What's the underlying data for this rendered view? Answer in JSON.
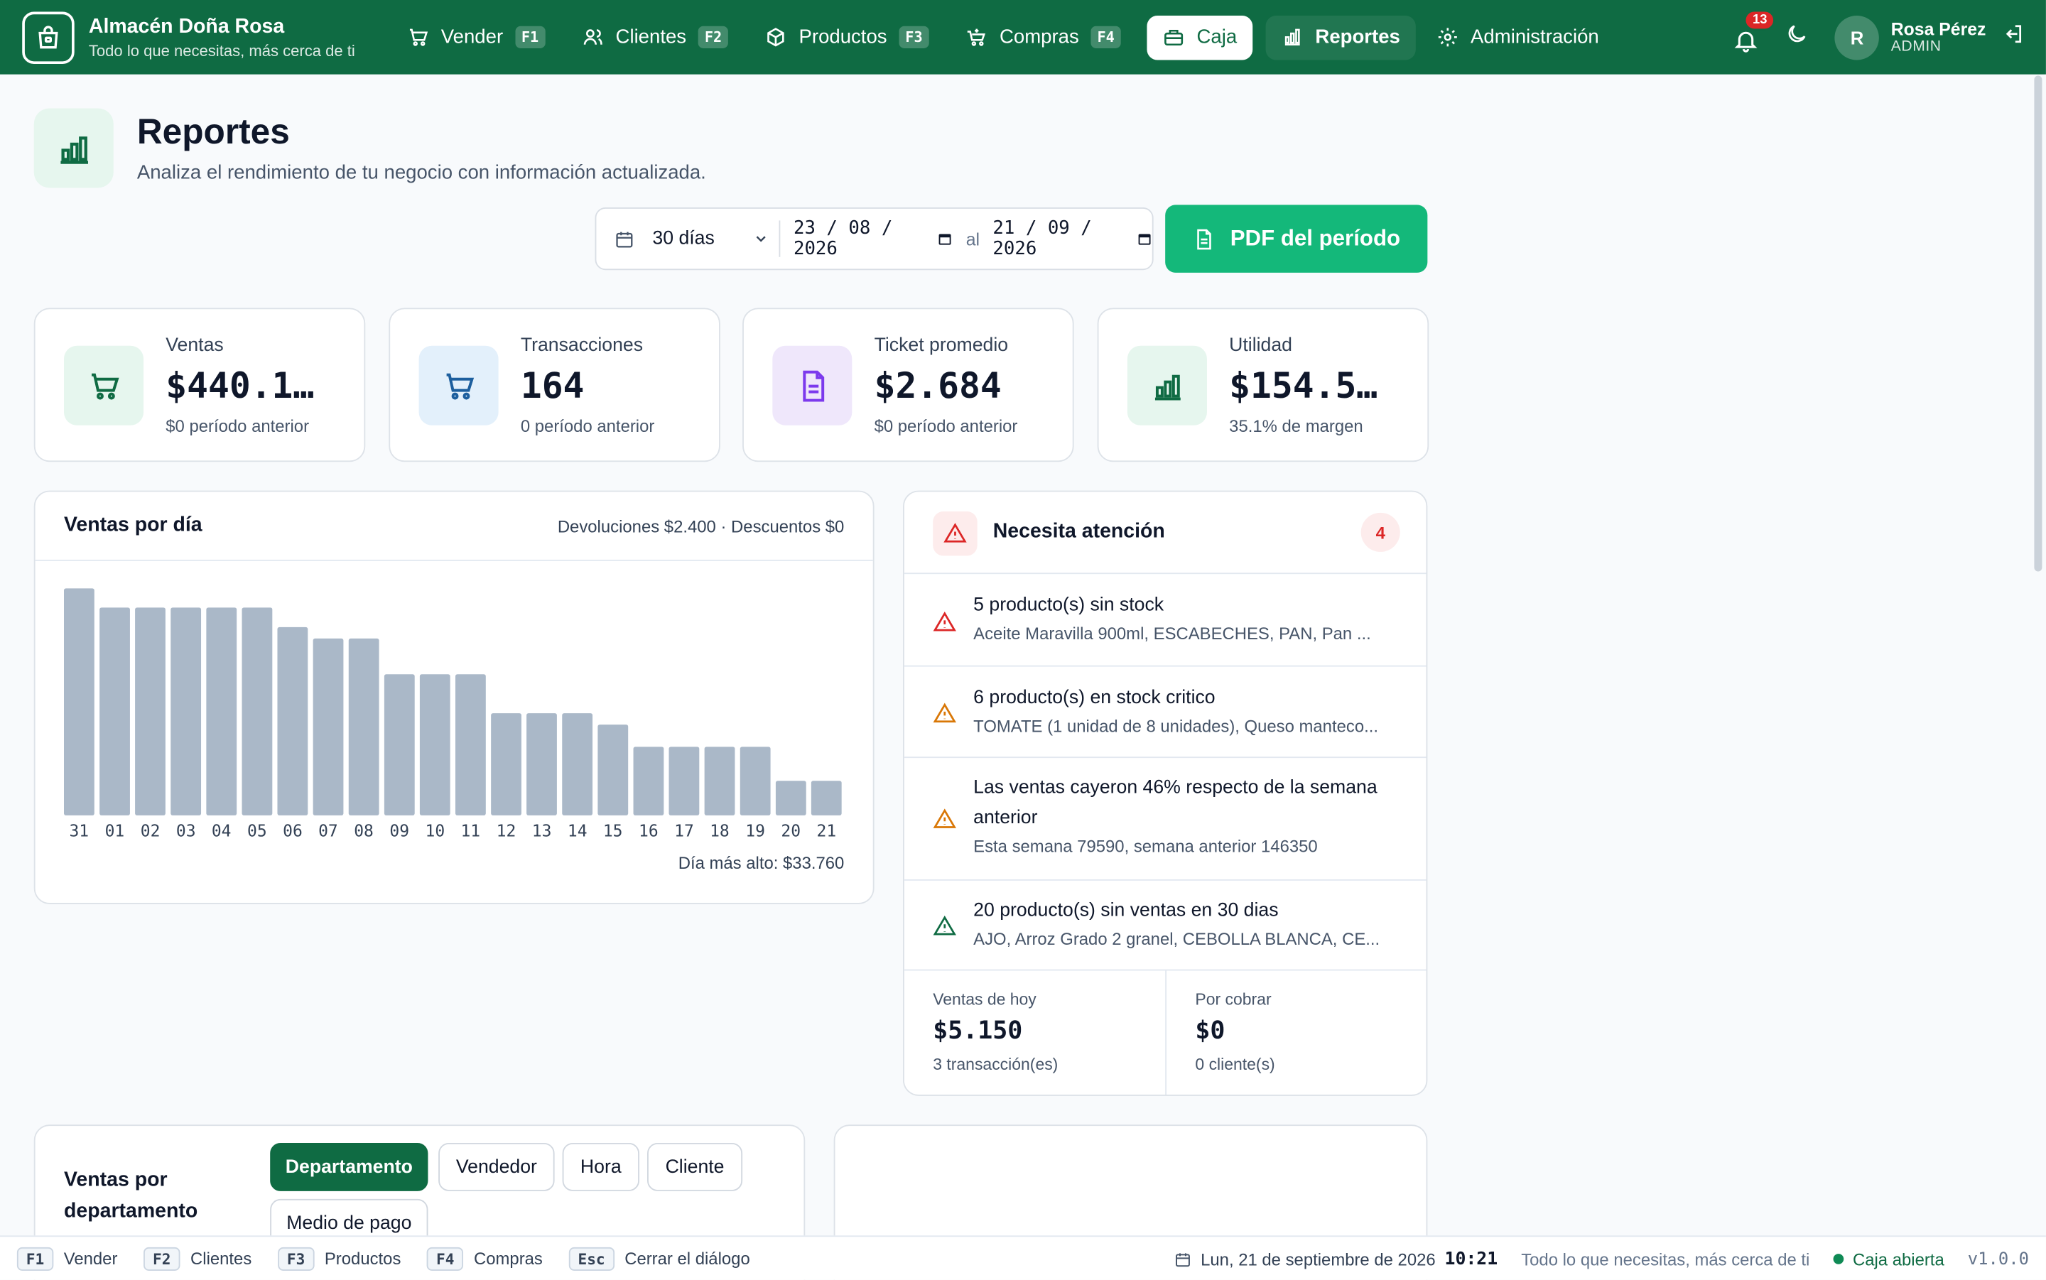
{
  "app": {
    "name": "Almacén Doña Rosa",
    "tagline": "Todo lo que necesitas, más cerca de ti"
  },
  "nav": [
    {
      "label": "Vender",
      "key": "F1",
      "icon": "cart-icon"
    },
    {
      "label": "Clientes",
      "key": "F2",
      "icon": "users-icon"
    },
    {
      "label": "Productos",
      "key": "F3",
      "icon": "box-icon"
    },
    {
      "label": "Compras",
      "key": "F4",
      "icon": "basket-icon"
    },
    {
      "label": "Caja",
      "key": "",
      "icon": "cash-register-icon"
    },
    {
      "label": "Reportes",
      "key": "",
      "icon": "bar-chart-icon"
    },
    {
      "label": "Administración",
      "key": "",
      "icon": "gear-icon"
    }
  ],
  "notifications": {
    "count": "13"
  },
  "user": {
    "initial": "R",
    "name": "Rosa Pérez",
    "role": "ADMIN"
  },
  "page": {
    "title": "Reportes",
    "subtitle": "Analiza el rendimiento de tu negocio con información actualizada."
  },
  "filters": {
    "range": "30 días",
    "from": "23 / 08 / 2026",
    "separator": "al",
    "to": "21 / 09 / 2026",
    "pdf_label": "PDF del período"
  },
  "kpis": [
    {
      "label": "Ventas",
      "value": "$440.1…",
      "sub": "$0 período anterior",
      "icon": "cart-icon",
      "bg": "#e6f6ee",
      "fg": "#0f6b43"
    },
    {
      "label": "Transacciones",
      "value": "164",
      "sub": "0 período anterior",
      "icon": "cart-icon",
      "bg": "#e3f0fb",
      "fg": "#1d5f9e"
    },
    {
      "label": "Ticket promedio",
      "value": "$2.684",
      "sub": "$0 período anterior",
      "icon": "document-icon",
      "bg": "#efe7fb",
      "fg": "#7c3aed"
    },
    {
      "label": "Utilidad",
      "value": "$154.5…",
      "sub": "35.1% de margen",
      "icon": "bar-chart-icon",
      "bg": "#e6f6ee",
      "fg": "#0f6b43"
    }
  ],
  "chart_data": {
    "type": "bar",
    "title": "Ventas por día",
    "note": "Devoluciones $2.400 · Descuentos $0",
    "categories": [
      "31",
      "01",
      "02",
      "03",
      "04",
      "05",
      "06",
      "07",
      "08",
      "09",
      "10",
      "11",
      "12",
      "13",
      "14",
      "15",
      "16",
      "17",
      "18",
      "19",
      "20",
      "21"
    ],
    "values": [
      33760,
      30900,
      30900,
      30900,
      30900,
      30900,
      28000,
      26300,
      26300,
      21000,
      21000,
      21000,
      15200,
      15200,
      15200,
      13500,
      10200,
      10200,
      10200,
      10200,
      5150,
      5150
    ],
    "ylim": [
      0,
      33760
    ],
    "footer": "Día más alto: $33.760",
    "bar_color": "#aab8c8"
  },
  "attention": {
    "title": "Necesita atención",
    "count": "4",
    "items": [
      {
        "title": "5 producto(s) sin stock",
        "detail": "Aceite Maravilla 900ml, ESCABECHES, PAN, Pan ...",
        "icon": "warning-icon",
        "color": "#dc2626"
      },
      {
        "title": "6 producto(s) en stock critico",
        "detail": "TOMATE (1 unidad de 8 unidades), Queso manteco...",
        "icon": "warning-icon",
        "color": "#d97706"
      },
      {
        "title": "Las ventas cayeron 46% respecto de la semana anterior",
        "detail": "Esta semana 79590, semana anterior 146350",
        "icon": "warning-icon",
        "color": "#d97706"
      },
      {
        "title": "20 producto(s) sin ventas en 30 dias",
        "detail": "AJO, Arroz Grado 2 granel, CEBOLLA BLANCA, CE...",
        "icon": "warning-icon",
        "color": "#0f6b43"
      }
    ],
    "today": {
      "label": "Ventas de hoy",
      "value": "$5.150",
      "sub": "3 transacción(es)"
    },
    "receivable": {
      "label": "Por cobrar",
      "value": "$0",
      "sub": "0 cliente(s)"
    }
  },
  "department": {
    "title": "Ventas por departamento",
    "tabs": [
      "Departamento",
      "Vendedor",
      "Hora",
      "Cliente",
      "Medio de pago"
    ],
    "active": "Departamento"
  },
  "statusbar": {
    "shortcuts": [
      {
        "key": "F1",
        "label": "Vender"
      },
      {
        "key": "F2",
        "label": "Clientes"
      },
      {
        "key": "F3",
        "label": "Productos"
      },
      {
        "key": "F4",
        "label": "Compras"
      },
      {
        "key": "Esc",
        "label": "Cerrar el diálogo"
      }
    ],
    "date": "Lun, 21 de septiembre de 2026",
    "time": "10:21",
    "tagline": "Todo lo que necesitas, más cerca de ti",
    "register": "Caja abierta",
    "version": "v1.0.0"
  },
  "colors": {
    "brand": "#0f6b43",
    "accent": "#14b87a",
    "danger": "#dc2626",
    "warning": "#d97706"
  }
}
